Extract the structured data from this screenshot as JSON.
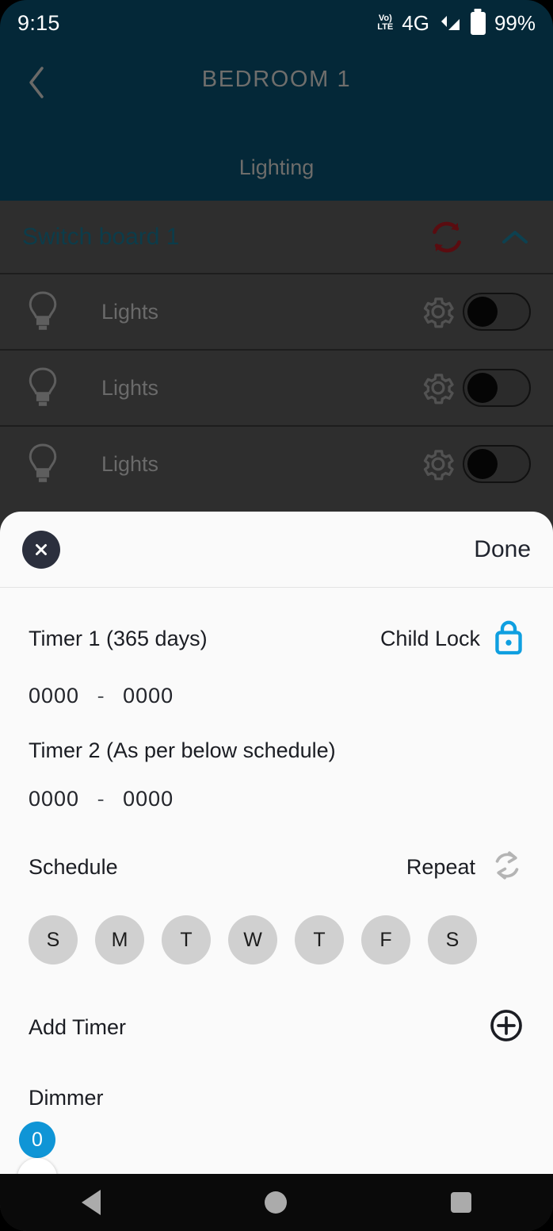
{
  "status_bar": {
    "time": "9:15",
    "volte_top": "Vo)",
    "volte_bottom": "LTE",
    "network": "4G",
    "battery_percent": "99%"
  },
  "app_header": {
    "back_icon": "chevron-left-icon",
    "title": "BEDROOM 1",
    "tabs": [
      {
        "label": "Lighting",
        "active": true
      }
    ]
  },
  "switch_board": {
    "title": "Switch board 1",
    "refresh_icon": "refresh-icon",
    "collapse_icon": "chevron-up-icon",
    "rows": [
      {
        "icon": "lightbulb-icon",
        "label": "Lights",
        "settings_icon": "gear-icon",
        "toggle_state": "off"
      },
      {
        "icon": "lightbulb-icon",
        "label": "Lights",
        "settings_icon": "gear-icon",
        "toggle_state": "off"
      },
      {
        "icon": "lightbulb-icon",
        "label": "Lights",
        "settings_icon": "gear-icon",
        "toggle_state": "off"
      }
    ]
  },
  "sheet": {
    "close_icon": "close-icon",
    "done_label": "Done",
    "timer1": {
      "title": "Timer 1 (365 days)",
      "start": "0000",
      "dash": "-",
      "end": "0000"
    },
    "child_lock": {
      "label": "Child Lock",
      "icon": "lock-icon",
      "color": "#0f9fe0"
    },
    "timer2": {
      "title": "Timer 2 (As per below schedule)",
      "start": "0000",
      "dash": "-",
      "end": "0000"
    },
    "schedule": {
      "label": "Schedule",
      "repeat_label": "Repeat",
      "repeat_icon": "repeat-icon",
      "days": [
        {
          "label": "S",
          "selected": false
        },
        {
          "label": "M",
          "selected": false
        },
        {
          "label": "T",
          "selected": false
        },
        {
          "label": "W",
          "selected": false
        },
        {
          "label": "T",
          "selected": false
        },
        {
          "label": "F",
          "selected": false
        },
        {
          "label": "S",
          "selected": false
        }
      ]
    },
    "add_timer": {
      "label": "Add Timer",
      "icon": "plus-circle-icon"
    },
    "dimmer": {
      "label": "Dimmer",
      "value": "0",
      "min": "0",
      "max": "100",
      "badge_color": "#0f95d6"
    }
  },
  "nav_bar": {
    "back_icon": "nav-back-icon",
    "home_icon": "nav-home-icon",
    "recents_icon": "nav-recents-icon"
  }
}
